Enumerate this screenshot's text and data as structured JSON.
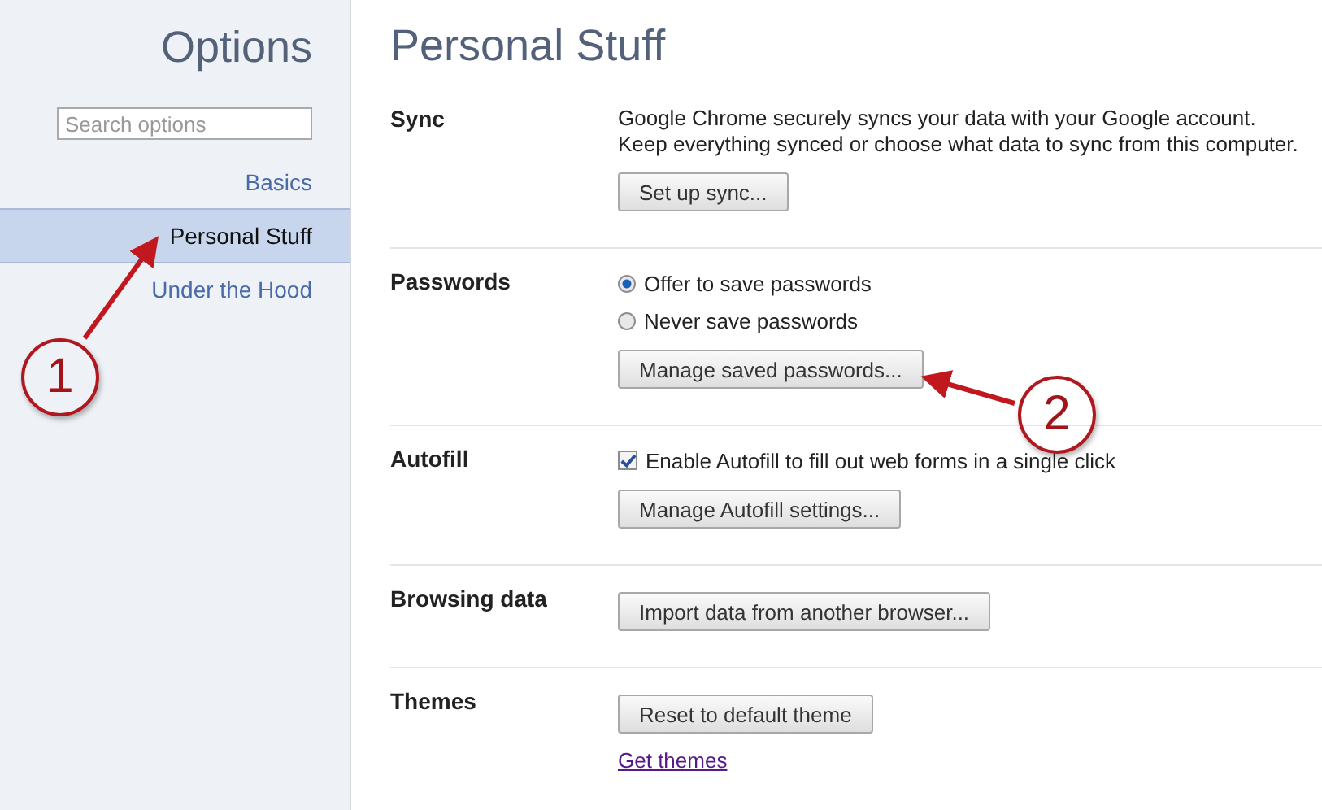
{
  "sidebar": {
    "title": "Options",
    "search": {
      "placeholder": "Search options"
    },
    "items": [
      {
        "label": "Basics",
        "selected": false
      },
      {
        "label": "Personal Stuff",
        "selected": true
      },
      {
        "label": "Under the Hood",
        "selected": false
      }
    ]
  },
  "page": {
    "title": "Personal Stuff",
    "sections": [
      {
        "label": "Sync",
        "controls": [
          {
            "kind": "text",
            "text": "Google Chrome securely syncs your data with your Google account.\nKeep everything synced or choose what data to sync from this computer."
          },
          {
            "kind": "button",
            "label": "Set up sync..."
          }
        ]
      },
      {
        "label": "Passwords",
        "controls": [
          {
            "kind": "radio",
            "label": "Offer to save passwords",
            "selected": true
          },
          {
            "kind": "radio",
            "label": "Never save passwords",
            "selected": false
          },
          {
            "kind": "button",
            "label": "Manage saved passwords..."
          }
        ]
      },
      {
        "label": "Autofill",
        "controls": [
          {
            "kind": "checkbox",
            "label": "Enable Autofill to fill out web forms in a single click",
            "checked": true
          },
          {
            "kind": "button",
            "label": "Manage Autofill settings..."
          }
        ]
      },
      {
        "label": "Browsing data",
        "controls": [
          {
            "kind": "button",
            "label": "Import data from another browser..."
          }
        ]
      },
      {
        "label": "Themes",
        "controls": [
          {
            "kind": "button",
            "label": "Reset to default theme"
          },
          {
            "kind": "link",
            "label": "Get themes"
          }
        ]
      }
    ]
  },
  "annotations": [
    {
      "number": "1"
    },
    {
      "number": "2"
    }
  ]
}
